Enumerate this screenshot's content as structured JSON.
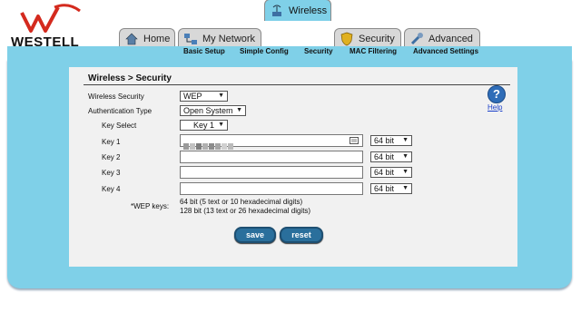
{
  "brand": {
    "name": "WESTELL",
    "logo_color": "#d42a1e"
  },
  "tabs": [
    {
      "label": "Home",
      "icon": "house-icon"
    },
    {
      "label": "My Network",
      "icon": "network-icon"
    },
    {
      "label": "Wireless",
      "icon": "wireless-icon",
      "active": true
    },
    {
      "label": "Security",
      "icon": "shield-icon"
    },
    {
      "label": "Advanced",
      "icon": "tools-icon"
    }
  ],
  "subnav": [
    "Basic Setup",
    "Simple Config",
    "Security",
    "MAC Filtering",
    "Advanced Settings"
  ],
  "page": {
    "title": "Wireless > Security"
  },
  "form": {
    "wireless_security": {
      "label": "Wireless Security",
      "value": "WEP"
    },
    "auth_type": {
      "label": "Authentication Type",
      "value": "Open System"
    },
    "key_select": {
      "label": "Key Select",
      "value": "Key 1"
    },
    "keys": [
      {
        "label": "Key 1",
        "bits": "64 bit"
      },
      {
        "label": "Key 2",
        "bits": "64 bit"
      },
      {
        "label": "Key 3",
        "bits": "64 bit"
      },
      {
        "label": "Key 4",
        "bits": "64 bit"
      }
    ],
    "wep_note_label": "*WEP keys:",
    "wep_note_lines": [
      "64 bit (5 text or 10 hexadecimal digits)",
      "128 bit (13 text or 26 hexadecimal digits)"
    ]
  },
  "help": {
    "label": "Help"
  },
  "buttons": {
    "save": "save",
    "reset": "reset"
  },
  "colors": {
    "accent": "#7fd0e8",
    "button": "#2a6f9c"
  }
}
